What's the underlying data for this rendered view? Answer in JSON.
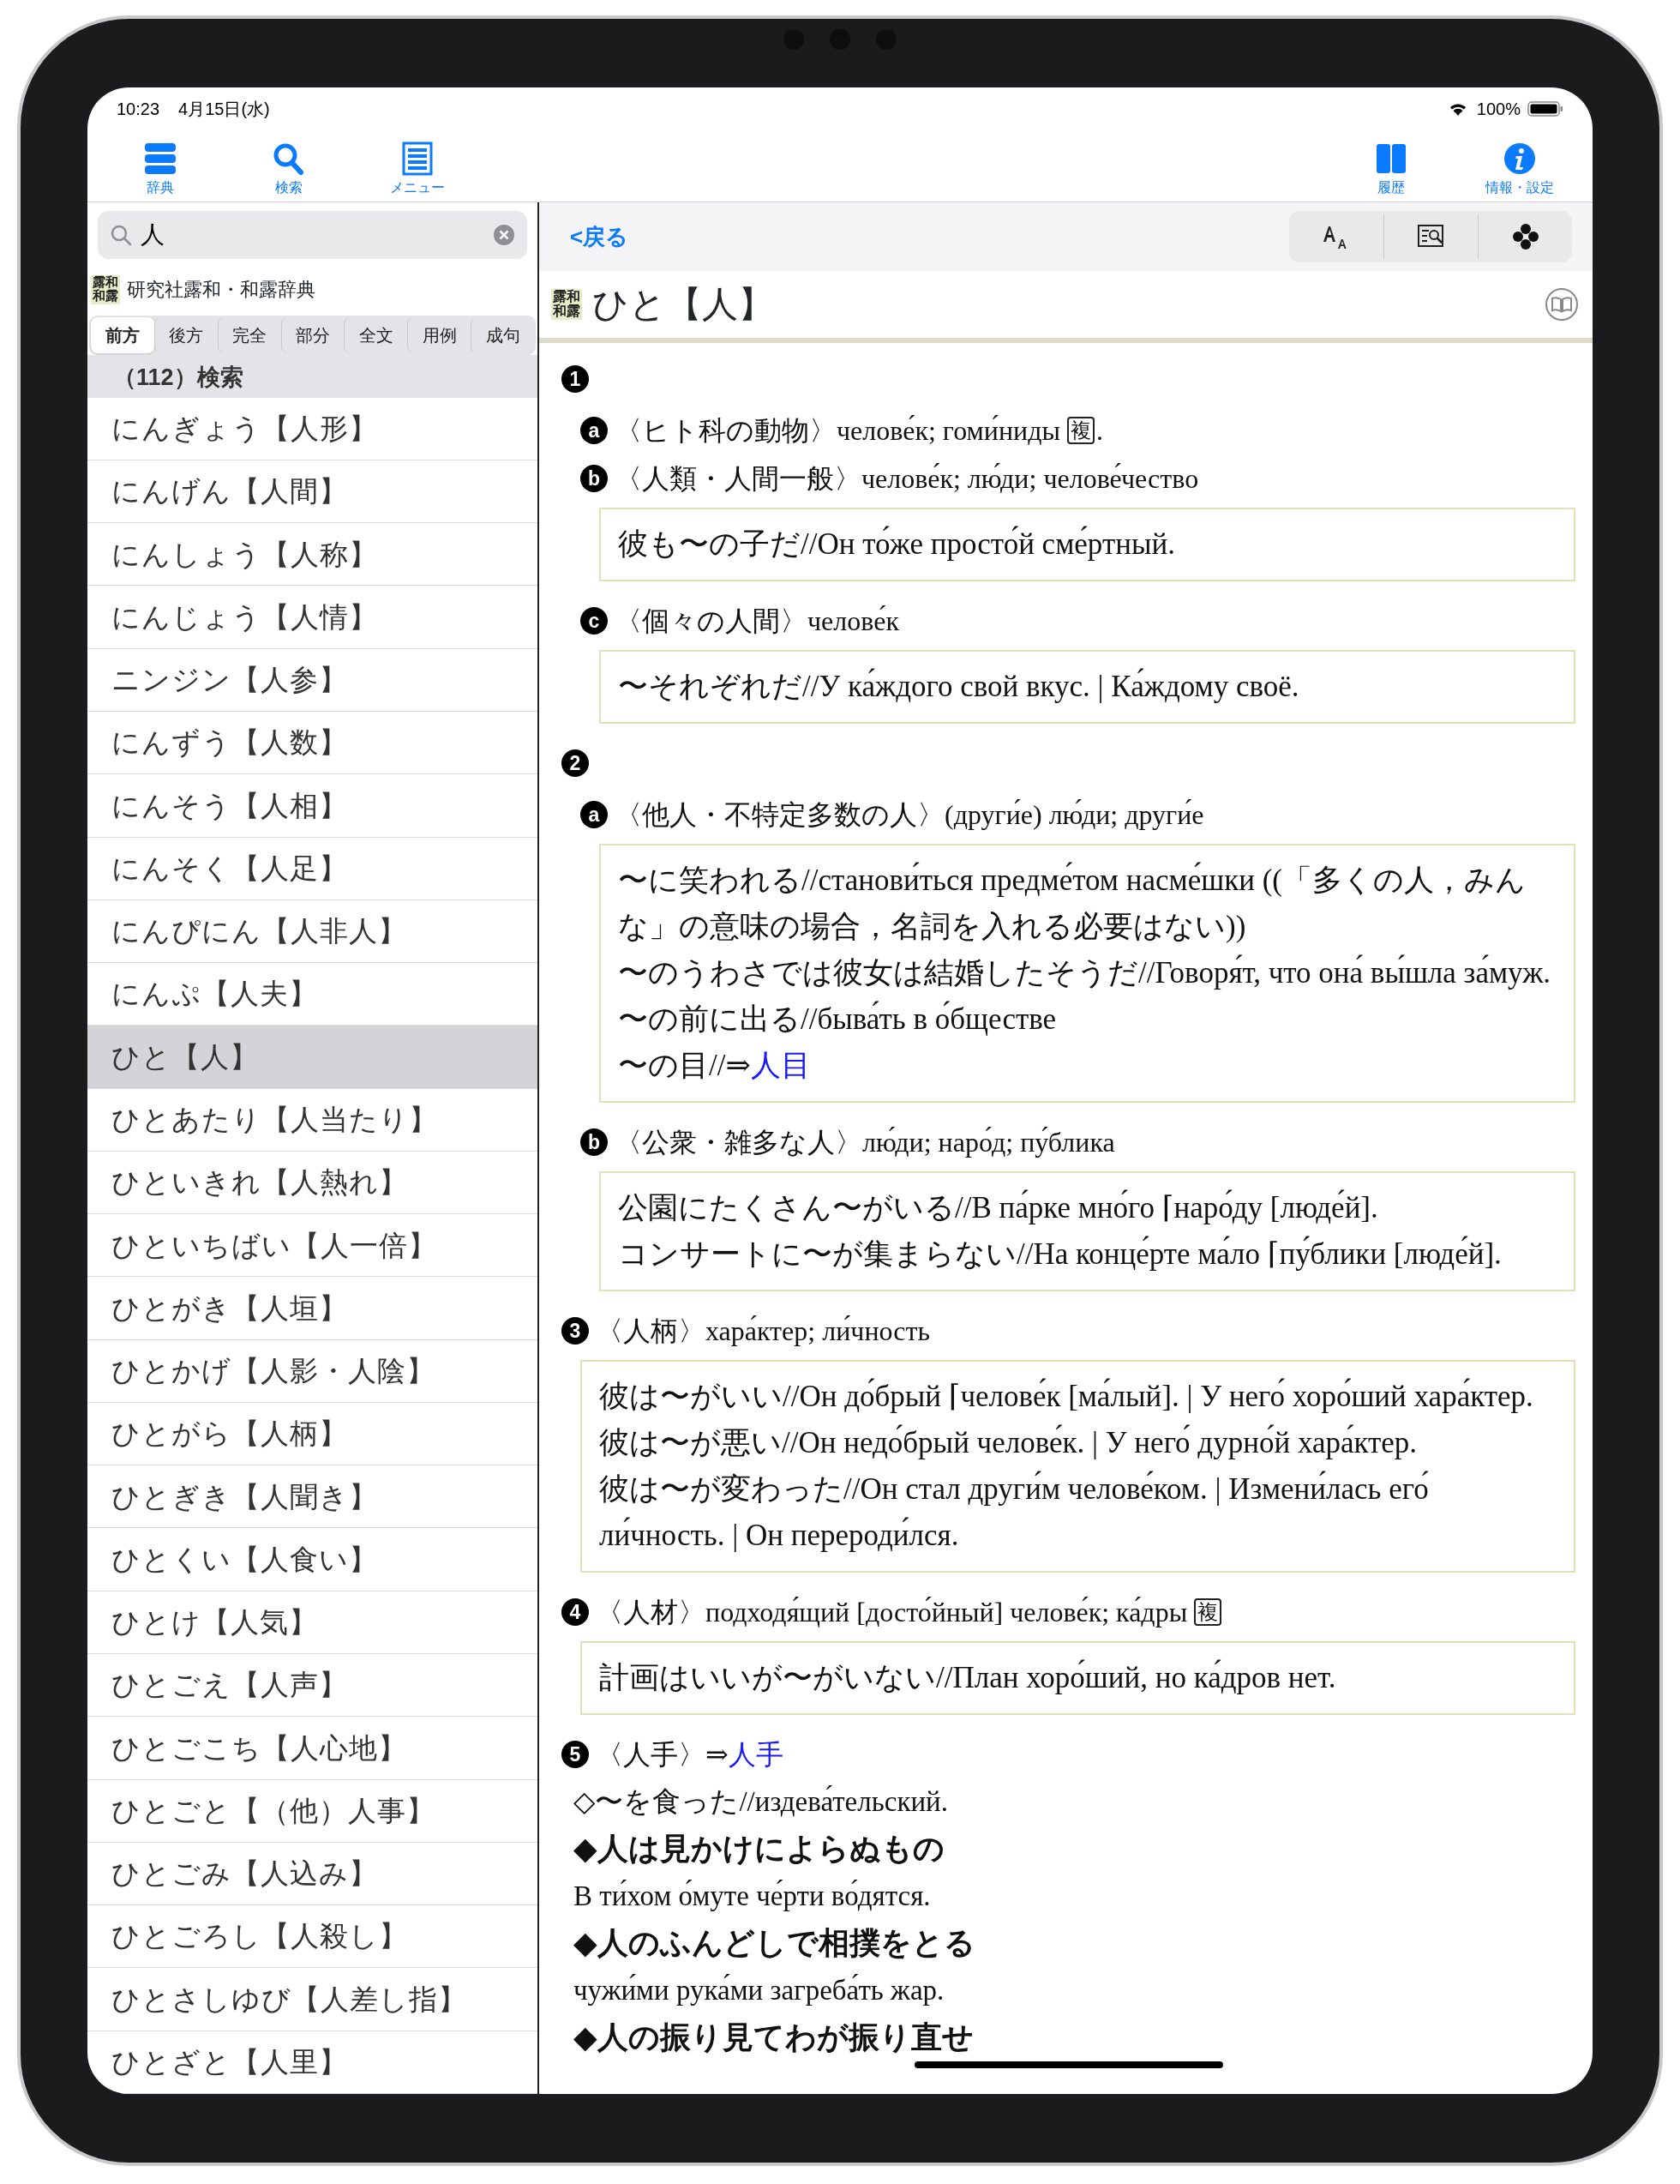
{
  "status_bar": {
    "time": "10:23",
    "date": "4月15日(水)",
    "battery": "100%"
  },
  "toolbar": {
    "left": [
      {
        "kind": "dictionaries",
        "label": "辞典"
      },
      {
        "kind": "search",
        "label": "検索"
      },
      {
        "kind": "menu",
        "label": "メニュー"
      }
    ],
    "right": [
      {
        "kind": "history",
        "label": "履歴"
      },
      {
        "kind": "info",
        "label": "情報・設定"
      }
    ]
  },
  "search": {
    "value": "人"
  },
  "dictionary": {
    "badge_top": "露和",
    "badge_bottom": "和露",
    "name": "研究社露和・和露辞典"
  },
  "search_modes": [
    {
      "label": "前方",
      "selected": true
    },
    {
      "label": "後方",
      "selected": false
    },
    {
      "label": "完全",
      "selected": false
    },
    {
      "label": "部分",
      "selected": false
    },
    {
      "label": "全文",
      "selected": false
    },
    {
      "label": "用例",
      "selected": false
    },
    {
      "label": "成句",
      "selected": false
    }
  ],
  "results": {
    "header": "（112）検索",
    "items": [
      {
        "label": "にんぎょう【人形】",
        "selected": false
      },
      {
        "label": "にんげん【人間】",
        "selected": false
      },
      {
        "label": "にんしょう【人称】",
        "selected": false
      },
      {
        "label": "にんじょう【人情】",
        "selected": false
      },
      {
        "label": "ニンジン【人参】",
        "selected": false
      },
      {
        "label": "にんずう【人数】",
        "selected": false
      },
      {
        "label": "にんそう【人相】",
        "selected": false
      },
      {
        "label": "にんそく【人足】",
        "selected": false
      },
      {
        "label": "にんぴにん【人非人】",
        "selected": false
      },
      {
        "label": "にんぷ【人夫】",
        "selected": false
      },
      {
        "label": "ひと【人】",
        "selected": true
      },
      {
        "label": "ひとあたり【人当たり】",
        "selected": false
      },
      {
        "label": "ひといきれ【人熱れ】",
        "selected": false
      },
      {
        "label": "ひといちばい【人一倍】",
        "selected": false
      },
      {
        "label": "ひとがき【人垣】",
        "selected": false
      },
      {
        "label": "ひとかげ【人影・人陰】",
        "selected": false
      },
      {
        "label": "ひとがら【人柄】",
        "selected": false
      },
      {
        "label": "ひとぎき【人聞き】",
        "selected": false
      },
      {
        "label": "ひとくい【人食い】",
        "selected": false
      },
      {
        "label": "ひとけ【人気】",
        "selected": false
      },
      {
        "label": "ひとごえ【人声】",
        "selected": false
      },
      {
        "label": "ひとごこち【人心地】",
        "selected": false
      },
      {
        "label": "ひとごと【（他）人事】",
        "selected": false
      },
      {
        "label": "ひとごみ【人込み】",
        "selected": false
      },
      {
        "label": "ひとごろし【人殺し】",
        "selected": false
      },
      {
        "label": "ひとさしゆび【人差し指】",
        "selected": false
      },
      {
        "label": "ひとざと【人里】",
        "selected": false
      }
    ]
  },
  "entry_nav": {
    "back": "<戻る"
  },
  "entry": {
    "badge_top": "露和",
    "badge_bottom": "和露",
    "headword": "ひと【人】",
    "blocks": [
      {
        "kind": "sense",
        "marker": "1"
      },
      {
        "kind": "subsense",
        "marker": "a",
        "text": "〈ヒト科の動物〉челове́к; гоми́ниды",
        "tag": "複",
        "suffix": "."
      },
      {
        "kind": "subsense",
        "marker": "b",
        "text": "〈人類・人間一般〉челове́к; лю́ди; челове́чество"
      },
      {
        "kind": "examples",
        "lines": [
          {
            "text": "彼も〜の子だ//Он то́же просто́й сме́ртный."
          }
        ]
      },
      {
        "kind": "subsense",
        "marker": "c",
        "text": "〈個々の人間〉челове́к"
      },
      {
        "kind": "examples",
        "lines": [
          {
            "text": "〜それぞれだ//У ка́ждого свой вкус. | Ка́ждому своё."
          }
        ]
      },
      {
        "kind": "sense",
        "marker": "2"
      },
      {
        "kind": "subsense",
        "marker": "a",
        "text": "〈他人・不特定多数の人〉(други́е) лю́ди; други́е"
      },
      {
        "kind": "examples",
        "lines": [
          {
            "text": "〜に笑われる//станови́ться предме́том насме́шки ((「多くの人，みんな」の意味の場合，名詞を入れる必要はない))"
          },
          {
            "text": "〜のうわさでは彼女は結婚したそうだ//Говоря́т, что она́ вы́шла за́муж."
          },
          {
            "text": "〜の前に出る//быва́ть в о́бществе"
          },
          {
            "text": "〜の目//⇒",
            "link": "人目"
          }
        ]
      },
      {
        "kind": "subsense",
        "marker": "b",
        "text": "〈公衆・雑多な人〉лю́ди; наро́д; пу́блика"
      },
      {
        "kind": "examples",
        "lines": [
          {
            "text": "公園にたくさん〜がいる//В па́рке мно́го ⌈наро́ду [люде́й]."
          },
          {
            "text": "コンサートに〜が集まらない//На конце́рте ма́ло ⌈пу́блики [люде́й]."
          }
        ]
      },
      {
        "kind": "sense",
        "marker": "3",
        "text": "〈人柄〉хара́ктер; ли́чность"
      },
      {
        "kind": "examples",
        "lines": [
          {
            "text": "彼は〜がいい//Он до́брый ⌈челове́к [ма́лый]. | У него́ хоро́ший хара́ктер."
          },
          {
            "text": "彼は〜が悪い//Он недо́брый челове́к. | У него́ дурно́й хара́ктер."
          },
          {
            "text": "彼は〜が変わった//Он стал други́м челове́ком. | Измени́лась его́ ли́чность. | Он перероди́лся."
          }
        ]
      },
      {
        "kind": "sense",
        "marker": "4",
        "text": "〈人材〉подходя́щий [досто́йный] челове́к; ка́дры",
        "tag": "複"
      },
      {
        "kind": "examples",
        "lines": [
          {
            "text": "計画はいいが〜がいない//План хоро́ший, но ка́дров нет."
          }
        ]
      },
      {
        "kind": "sense",
        "marker": "5",
        "text": "〈人手〉⇒",
        "link": "人手"
      },
      {
        "kind": "phrase",
        "text": "◇〜を食った//издева́тельский."
      },
      {
        "kind": "idiom",
        "text": "◆人は見かけによらぬもの"
      },
      {
        "kind": "translation",
        "text": "В ти́хом о́муте че́рти во́дятся."
      },
      {
        "kind": "idiom",
        "text": "◆人のふんどしで相撲をとる"
      },
      {
        "kind": "translation",
        "text": "чужи́ми рука́ми загреба́ть жар."
      },
      {
        "kind": "idiom",
        "text": "◆人の振り見てわが振り直せ"
      }
    ]
  }
}
